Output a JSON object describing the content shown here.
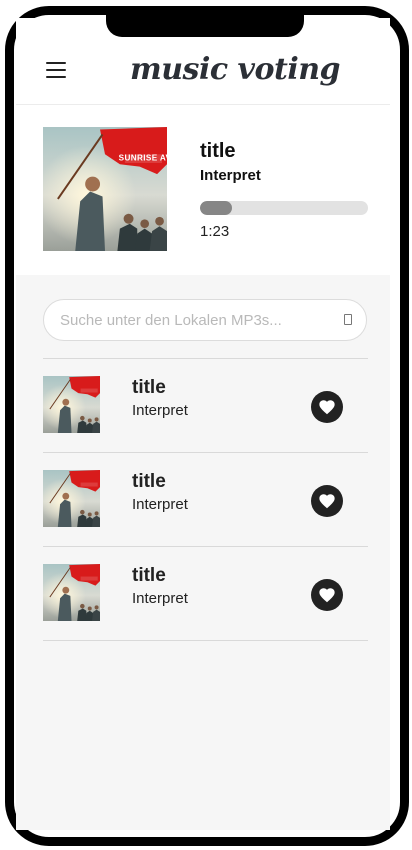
{
  "header": {
    "menu_icon": "hamburger-menu-icon",
    "title": "music voting"
  },
  "now_playing": {
    "cover_text": "SUNRISE AVE",
    "title": "title",
    "artist": "Interpret",
    "progress": 0.19,
    "time": "1:23"
  },
  "search": {
    "placeholder": "Suche unter den Lokalen MP3s...",
    "value": "",
    "icon": "search-icon"
  },
  "songs": [
    {
      "title": "title",
      "artist": "Interpret",
      "vote_icon": "heart-icon"
    },
    {
      "title": "title",
      "artist": "Interpret",
      "vote_icon": "heart-icon"
    },
    {
      "title": "title",
      "artist": "Interpret",
      "vote_icon": "heart-icon"
    }
  ],
  "colors": {
    "accent_dark": "#222222",
    "progress_fill": "#868686",
    "progress_track": "#e2e2e2",
    "cover_flag": "#d81b1b"
  }
}
